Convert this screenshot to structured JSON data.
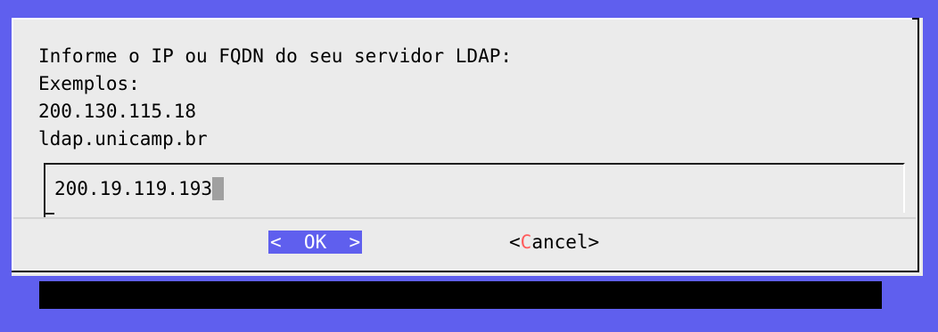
{
  "dialog": {
    "prompt_lines": [
      "Informe o IP ou FQDN do seu servidor LDAP:",
      "Exemplos:",
      "200.130.115.18",
      "ldap.unicamp.br"
    ],
    "input_value": "200.19.119.193",
    "ok_label": "<  OK  >",
    "cancel": {
      "open": "<",
      "hotkey": "C",
      "rest": "ancel>"
    }
  },
  "colors": {
    "background": "#5f5fee",
    "dialog": "#ebebeb",
    "selected_button": "#5f5fee",
    "hotkey": "#ff5a5a",
    "shadow": "#000000"
  }
}
